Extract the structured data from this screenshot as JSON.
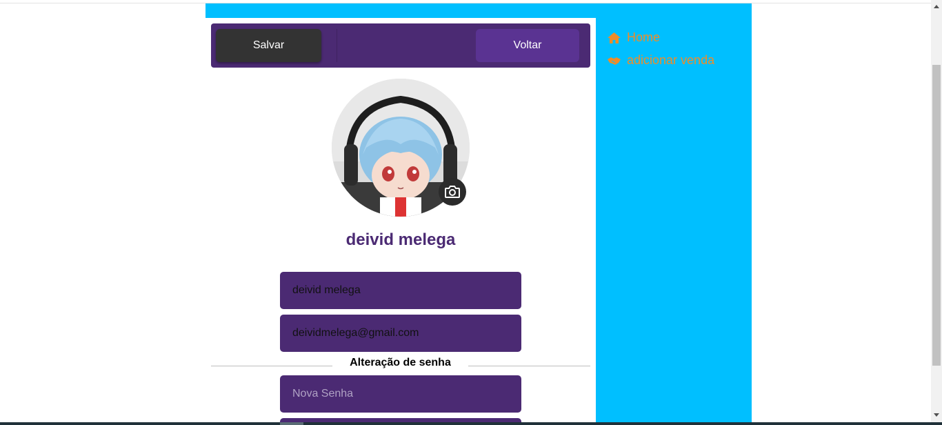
{
  "toolbar": {
    "save_label": "Salvar",
    "back_label": "Voltar"
  },
  "profile": {
    "name": "deivid melega",
    "avatar_icon": "user-avatar-photo",
    "camera_icon": "camera-icon"
  },
  "form": {
    "name_value": "deivid melega",
    "email_value": "deividmelega@gmail.com",
    "password_section_title": "Alteração de senha",
    "new_password_placeholder": "Nova Senha"
  },
  "sidebar": {
    "items": [
      {
        "label": "Home",
        "icon": "home-icon"
      },
      {
        "label": "adicionar venda",
        "icon": "handshake-icon"
      }
    ]
  },
  "colors": {
    "primary_purple": "#4b2a73",
    "accent_blue": "#00bfff",
    "link_orange": "#f08c28",
    "save_button": "#333333"
  }
}
